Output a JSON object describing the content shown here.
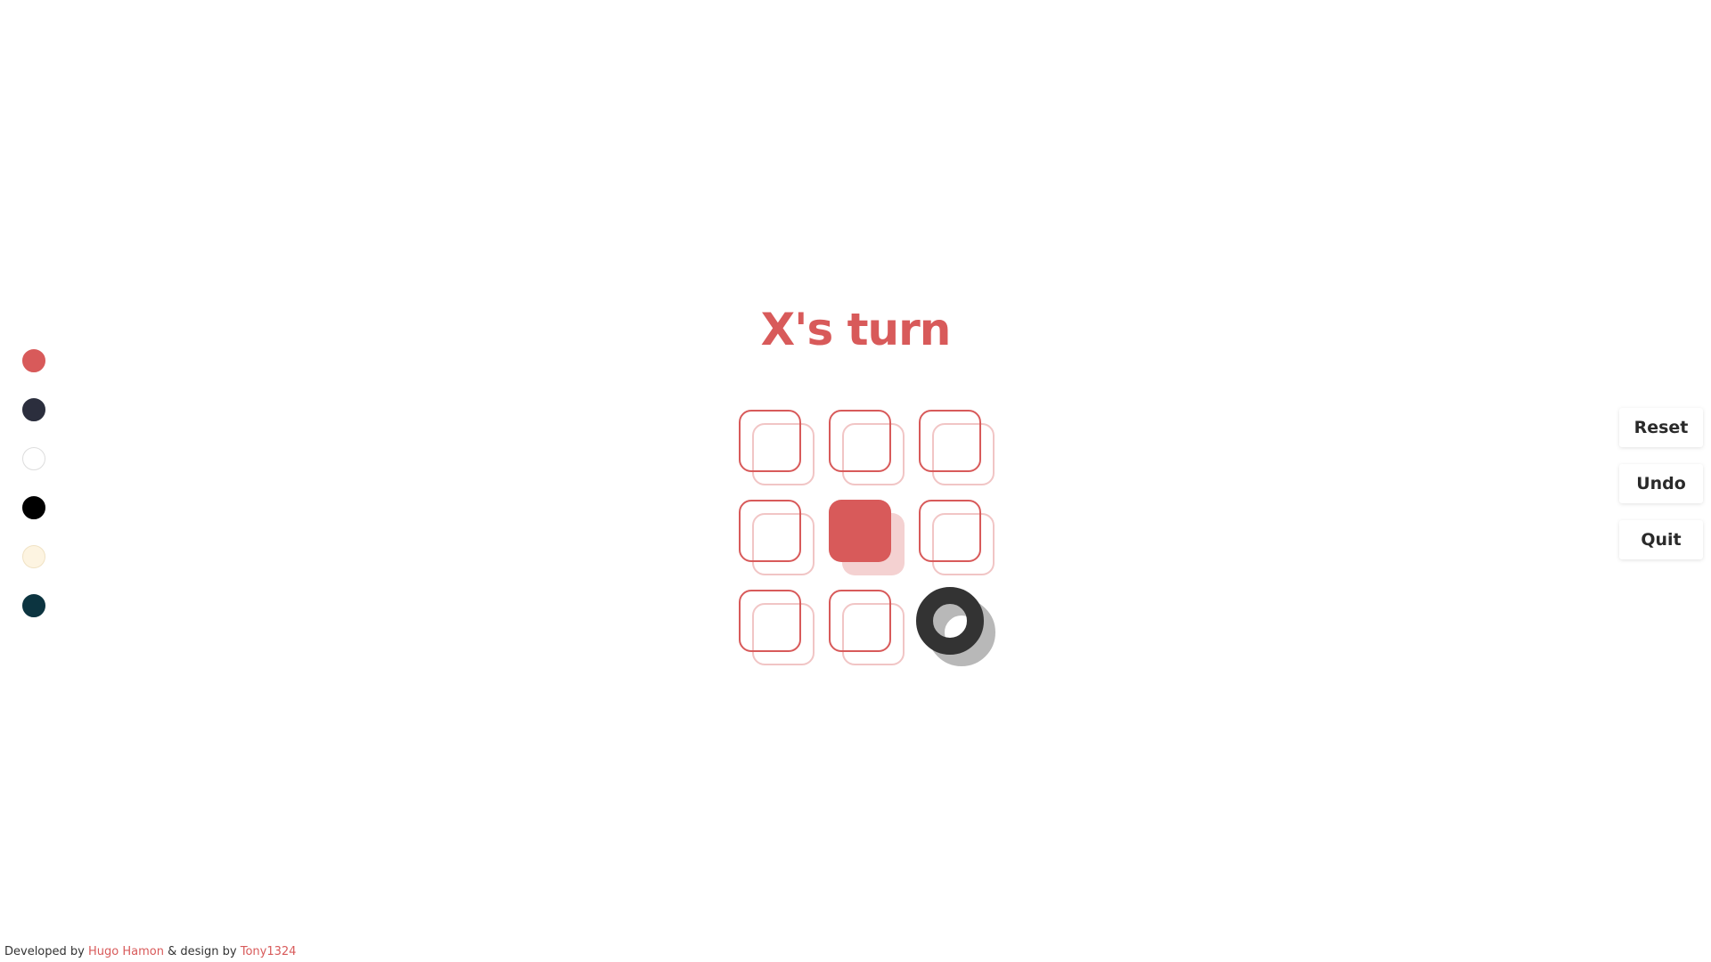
{
  "theme": {
    "accent": "#d85a5a",
    "dark": "#333333"
  },
  "header": {
    "turn_text": "X's turn"
  },
  "palette": {
    "swatches": [
      {
        "name": "red",
        "color": "#d85a5a",
        "border": "#d85a5a"
      },
      {
        "name": "navy",
        "color": "#2b2e3d",
        "border": "#2b2e3d"
      },
      {
        "name": "white",
        "color": "#ffffff",
        "border": "#dddddd"
      },
      {
        "name": "black",
        "color": "#000000",
        "border": "#000000"
      },
      {
        "name": "cream",
        "color": "#fdf4e1",
        "border": "#f0e2c4"
      },
      {
        "name": "dark-teal",
        "color": "#0c3440",
        "border": "#0c3440"
      }
    ]
  },
  "board": {
    "cells": [
      "",
      "",
      "",
      "",
      "X",
      "",
      "",
      "",
      "O"
    ]
  },
  "actions": {
    "reset_label": "Reset",
    "undo_label": "Undo",
    "quit_label": "Quit"
  },
  "footer": {
    "developed_by_label": "Developed by",
    "developer_name": "Hugo Hamon",
    "design_by_label": "& design by",
    "designer_name": "Tony1324"
  }
}
